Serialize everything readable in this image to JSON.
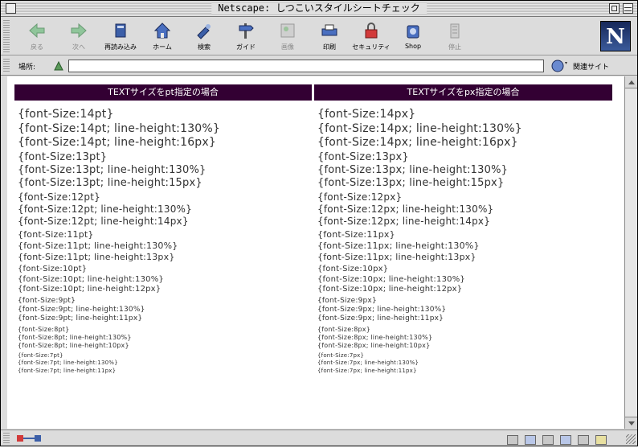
{
  "window": {
    "title": "Netscape: しつこいスタイルシートチェック"
  },
  "toolbar": {
    "buttons": [
      {
        "label": "戻る",
        "icon": "back-arrow-icon"
      },
      {
        "label": "次へ",
        "icon": "forward-arrow-icon"
      },
      {
        "label": "再読み込み",
        "icon": "reload-icon"
      },
      {
        "label": "ホーム",
        "icon": "home-icon"
      },
      {
        "label": "検索",
        "icon": "search-icon"
      },
      {
        "label": "ガイド",
        "icon": "guide-icon"
      },
      {
        "label": "画像",
        "icon": "images-icon"
      },
      {
        "label": "印刷",
        "icon": "print-icon"
      },
      {
        "label": "セキュリティ",
        "icon": "security-lock-icon"
      },
      {
        "label": "Shop",
        "icon": "shop-icon"
      },
      {
        "label": "停止",
        "icon": "stop-icon"
      }
    ],
    "logo_letter": "N"
  },
  "location": {
    "label": "場所:",
    "url": "",
    "related_label": "関連サイト"
  },
  "content": {
    "left": {
      "header": "TEXTサイズをpt指定の場合",
      "lines": [
        "{font-Size:14pt}",
        "{font-Size:14pt; line-height:130%}",
        "{font-Size:14pt; line-height:16px}",
        "{font-Size:13pt}",
        "{font-Size:13pt; line-height:130%}",
        "{font-Size:13pt; line-height:15px}",
        "{font-Size:12pt}",
        "{font-Size:12pt; line-height:130%}",
        "{font-Size:12pt; line-height:14px}",
        "{font-Size:11pt}",
        "{font-Size:11pt; line-height:130%}",
        "{font-Size:11pt; line-height:13px}",
        "{font-Size:10pt}",
        "{font-Size:10pt; line-height:130%}",
        "{font-Size:10pt; line-height:12px}",
        "{font-Size:9pt}",
        "{font-Size:9pt; line-height:130%}",
        "{font-Size:9pt; line-height:11px}",
        "{font-Size:8pt}",
        "{font-Size:8pt; line-height:130%}",
        "{font-Size:8pt; line-height:10px}",
        "{font-Size:7pt}",
        "{font-Size:7pt; line-height:130%}",
        "{font-Size:7pt; line-height:11px}"
      ]
    },
    "right": {
      "header": "TEXTサイズをpx指定の場合",
      "lines": [
        "{font-Size:14px}",
        "{font-Size:14px; line-height:130%}",
        "{font-Size:14px; line-height:16px}",
        "{font-Size:13px}",
        "{font-Size:13px; line-height:130%}",
        "{font-Size:13px; line-height:15px}",
        "{font-Size:12px}",
        "{font-Size:12px; line-height:130%}",
        "{font-Size:12px; line-height:14px}",
        "{font-Size:11px}",
        "{font-Size:11px; line-height:130%}",
        "{font-Size:11px; line-height:13px}",
        "{font-Size:10px}",
        "{font-Size:10px; line-height:130%}",
        "{font-Size:10px; line-height:12px}",
        "{font-Size:9px}",
        "{font-Size:9px; line-height:130%}",
        "{font-Size:9px; line-height:11px}",
        "{font-Size:8px}",
        "{font-Size:8px; line-height:130%}",
        "{font-Size:8px; line-height:10px}",
        "{font-Size:7px}",
        "{font-Size:7px; line-height:130%}",
        "{font-Size:7px; line-height:11px}"
      ]
    }
  },
  "statusbar": {
    "text": ""
  }
}
